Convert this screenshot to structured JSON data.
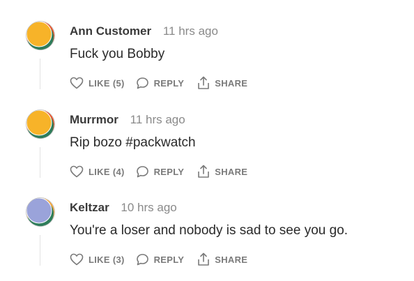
{
  "comments": [
    {
      "author": "Ann Customer",
      "time": "11 hrs ago",
      "text": "Fuck you Bobby",
      "like_label": "LIKE",
      "like_count": "(5)",
      "reply_label": "REPLY",
      "share_label": "SHARE",
      "avatar_colors": {
        "main": "#f7b329",
        "accent": "#2e7d5b",
        "rim": "#e8542a"
      }
    },
    {
      "author": "Murrmor",
      "time": "11 hrs ago",
      "text": "Rip bozo #packwatch",
      "like_label": "LIKE",
      "like_count": "(4)",
      "reply_label": "REPLY",
      "share_label": "SHARE",
      "avatar_colors": {
        "main": "#f7b329",
        "accent": "#2e7d5b",
        "rim": "#e8542a"
      }
    },
    {
      "author": "Keltzar",
      "time": "10 hrs ago",
      "text": "You're a loser and nobody is sad to see you go.",
      "like_label": "LIKE",
      "like_count": "(3)",
      "reply_label": "REPLY",
      "share_label": "SHARE",
      "avatar_colors": {
        "main": "#9aa3da",
        "accent": "#2e7d5b",
        "rim": "#f2a33a"
      }
    }
  ],
  "icons": {
    "like": "heart-icon",
    "reply": "speech-bubble-icon",
    "share": "share-upload-icon"
  },
  "colors": {
    "action_text": "#7a7a7a",
    "timestamp": "#8a8a8a",
    "thread_line": "#e2e2e2"
  }
}
